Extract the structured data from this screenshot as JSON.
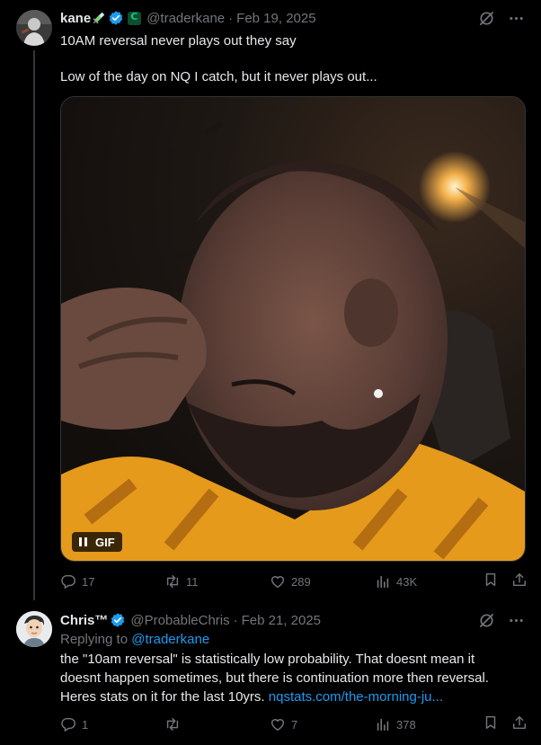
{
  "post": {
    "author_name": "kane",
    "handle": "@traderkane",
    "date": "Feb 19, 2025",
    "text_line1": "10AM reversal never plays out they say",
    "text_line2": "Low of the day on NQ I catch, but it never plays out...",
    "media": {
      "type": "gif",
      "label": "GIF"
    },
    "stats": {
      "replies": "17",
      "reposts": "11",
      "likes": "289",
      "views": "43K"
    }
  },
  "reply": {
    "author_name": "Chris™",
    "handle": "@ProbableChris",
    "date": "Feb 21, 2025",
    "replying_prefix": "Replying to",
    "replying_to": "@traderkane",
    "text_line1": "the \"10am reversal\" is statistically low probability. That doesnt mean it",
    "text_line2": "doesnt happen sometimes, but there is continuation more then reversal.",
    "text_line3": "Heres stats on it for the last 10yrs.",
    "link": "nqstats.com/the-morning-ju...",
    "stats": {
      "replies": "1",
      "reposts": "",
      "likes": "7",
      "views": "378"
    }
  },
  "separator": "·",
  "colors": {
    "background": "#000000",
    "text_primary": "#e7e9ea",
    "text_secondary": "#71767b",
    "accent_blue": "#1d9bf0",
    "border": "#2f3336"
  },
  "icons": [
    "verified-badge-icon",
    "syringe-emoji-icon",
    "affiliate-badge-icon",
    "grok-icon",
    "more-icon",
    "reply-icon",
    "repost-icon",
    "like-icon",
    "views-icon",
    "bookmark-icon",
    "share-icon",
    "pause-icon"
  ]
}
